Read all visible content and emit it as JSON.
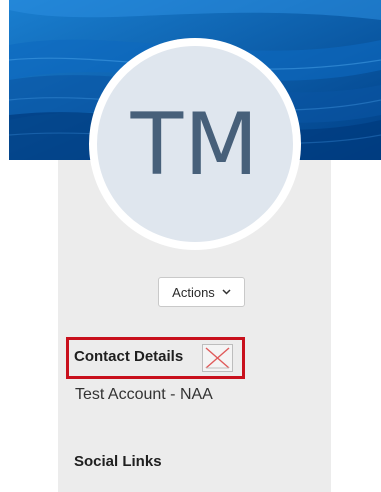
{
  "profile": {
    "initials": "TM",
    "actions_label": "Actions",
    "actions_icon": "chevron-down-icon"
  },
  "contact": {
    "heading": "Contact Details",
    "broken_icon": "broken-image-icon",
    "account_name": "Test Account - NAA",
    "highlight_color": "#c8101c"
  },
  "social": {
    "heading": "Social Links"
  },
  "colors": {
    "banner": "#0a62b0",
    "card": "#ececec",
    "avatar_bg": "#dfe6ee",
    "initials": "#47607a"
  }
}
